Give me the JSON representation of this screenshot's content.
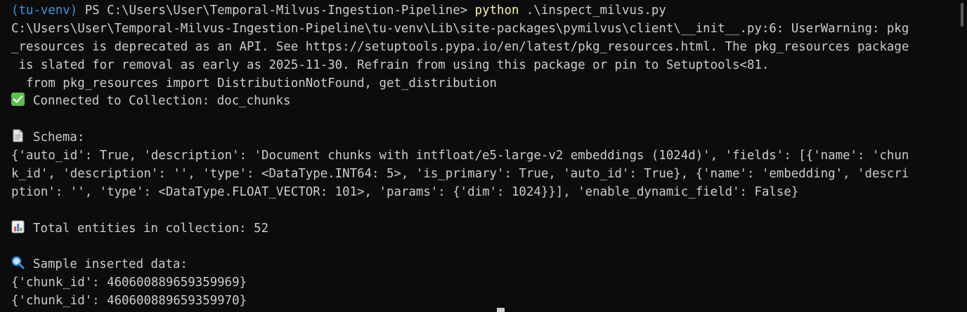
{
  "prompt": {
    "venv": "(tu-venv)",
    "ps": " PS C:\\Users\\User\\Temporal-Milvus-Ingestion-Pipeline> ",
    "command": "python",
    "args": " .\\inspect_milvus.py"
  },
  "output": {
    "warning_1": "C:\\Users\\User\\Temporal-Milvus-Ingestion-Pipeline\\tu-venv\\Lib\\site-packages\\pymilvus\\client\\__init__.py:6: UserWarning: pkg",
    "warning_2": "_resources is deprecated as an API. See https://setuptools.pypa.io/en/latest/pkg_resources.html. The pkg_resources package",
    "warning_3": " is slated for removal as early as 2025-11-30. Refrain from using this package or pin to Setuptools<81.",
    "warning_4": "  from pkg_resources import DistributionNotFound, get_distribution",
    "connected": "Connected to Collection: doc_chunks",
    "schema_label": "Schema:",
    "schema_1": "{'auto_id': True, 'description': 'Document chunks with intfloat/e5-large-v2 embeddings (1024d)', 'fields': [{'name': 'chun",
    "schema_2": "k_id', 'description': '', 'type': <DataType.INT64: 5>, 'is_primary': True, 'auto_id': True}, {'name': 'embedding', 'descri",
    "schema_3": "ption': '', 'type': <DataType.FLOAT_VECTOR: 101>, 'params': {'dim': 1024}}], 'enable_dynamic_field': False}",
    "total_entities": "Total entities in collection: 52",
    "sample_label": "Sample inserted data:",
    "sample_1": "{'chunk_id': 460600889659359969}",
    "sample_2": "{'chunk_id': 460600889659359970}"
  },
  "icons": {
    "connected": "check-mark-button-icon",
    "schema": "page-icon",
    "total": "bar-chart-icon",
    "sample": "magnifying-glass-icon"
  },
  "colors": {
    "background": "#0c0c0c",
    "text": "#cccccc",
    "venv": "#3a96dd",
    "command": "#f9f1a5",
    "check_green": "#5ac04a"
  }
}
